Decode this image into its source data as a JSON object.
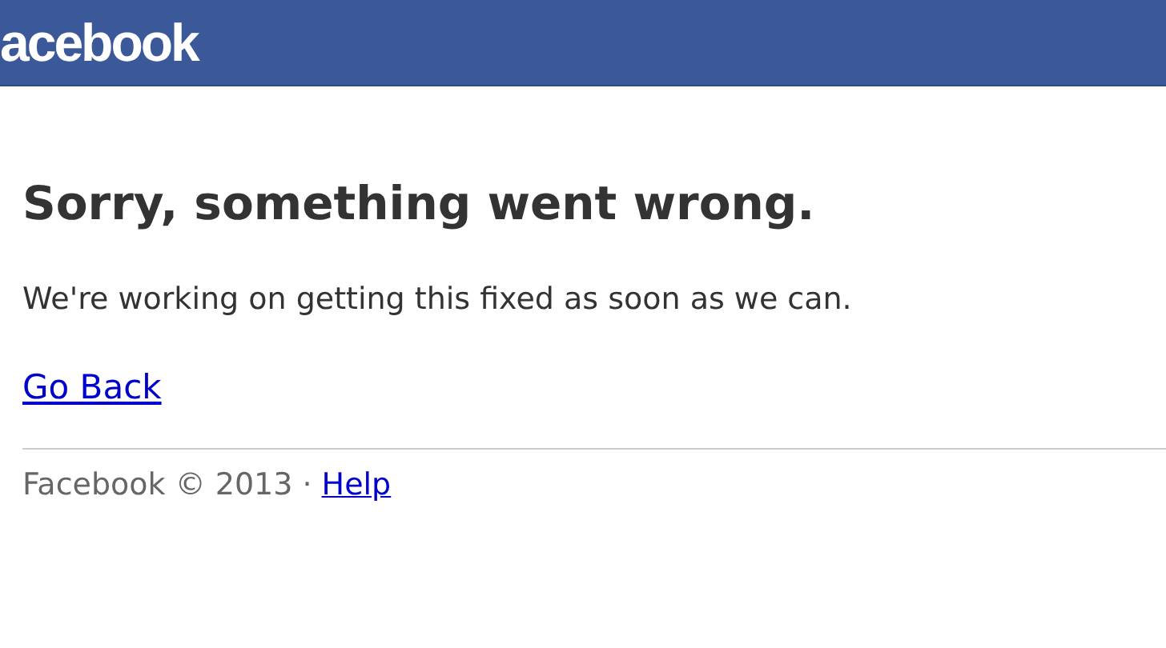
{
  "header": {
    "logo": "acebook"
  },
  "error": {
    "title": "Sorry, something went wrong.",
    "message": "We're working on getting this fixed as soon as we can.",
    "link": "Go Back"
  },
  "footer": {
    "copyright": "Facebook © 2013 ·",
    "link": "Help"
  }
}
